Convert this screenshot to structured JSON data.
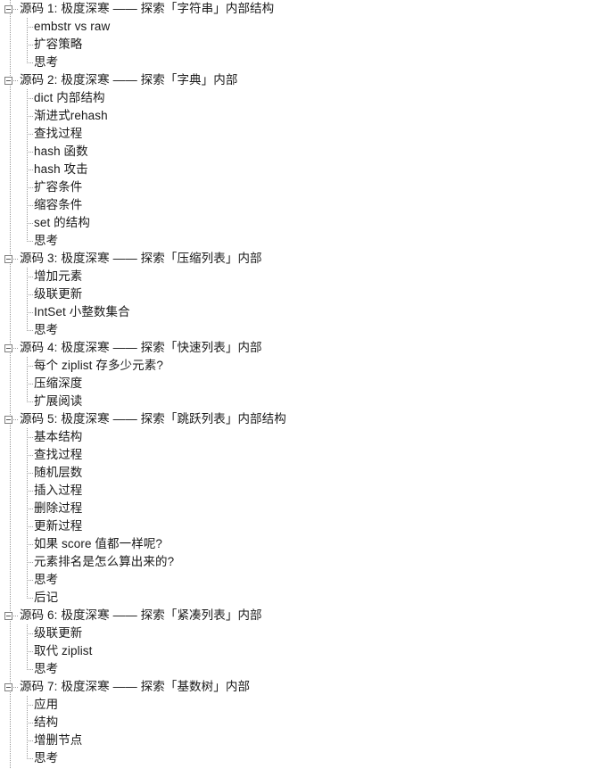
{
  "tree": {
    "toggle_icon": "minus-square-icon",
    "toggle_state": "expanded",
    "line_color": "#9a9a9a",
    "text_color": "#1a1a1a",
    "background_color": "#ffffff",
    "groups": [
      {
        "header": "源码 1: 极度深寒 —— 探索「字符串」内部结构",
        "children": [
          "embstr vs raw",
          "扩容策略",
          "思考"
        ]
      },
      {
        "header": "源码 2: 极度深寒 —— 探索「字典」内部",
        "children": [
          "dict 内部结构",
          "渐进式rehash",
          "查找过程",
          "hash 函数",
          "hash 攻击",
          "扩容条件",
          "缩容条件",
          "set 的结构",
          "思考"
        ]
      },
      {
        "header": "源码 3: 极度深寒 —— 探索「压缩列表」内部",
        "children": [
          "增加元素",
          "级联更新",
          "IntSet 小整数集合",
          "思考"
        ]
      },
      {
        "header": "源码 4: 极度深寒 —— 探索「快速列表」内部",
        "children": [
          "每个 ziplist 存多少元素?",
          "压缩深度",
          "扩展阅读"
        ]
      },
      {
        "header": "源码 5: 极度深寒 —— 探索「跳跃列表」内部结构",
        "children": [
          "基本结构",
          "查找过程",
          "随机层数",
          "插入过程",
          "删除过程",
          "更新过程",
          "如果 score 值都一样呢?",
          "元素排名是怎么算出来的?",
          "思考",
          "后记"
        ]
      },
      {
        "header": "源码 6: 极度深寒 —— 探索「紧凑列表」内部",
        "children": [
          "级联更新",
          "取代 ziplist",
          "思考"
        ]
      },
      {
        "header": "源码 7: 极度深寒 —— 探索「基数树」内部",
        "children": [
          "应用",
          "结构",
          "增删节点",
          "思考"
        ]
      }
    ]
  }
}
